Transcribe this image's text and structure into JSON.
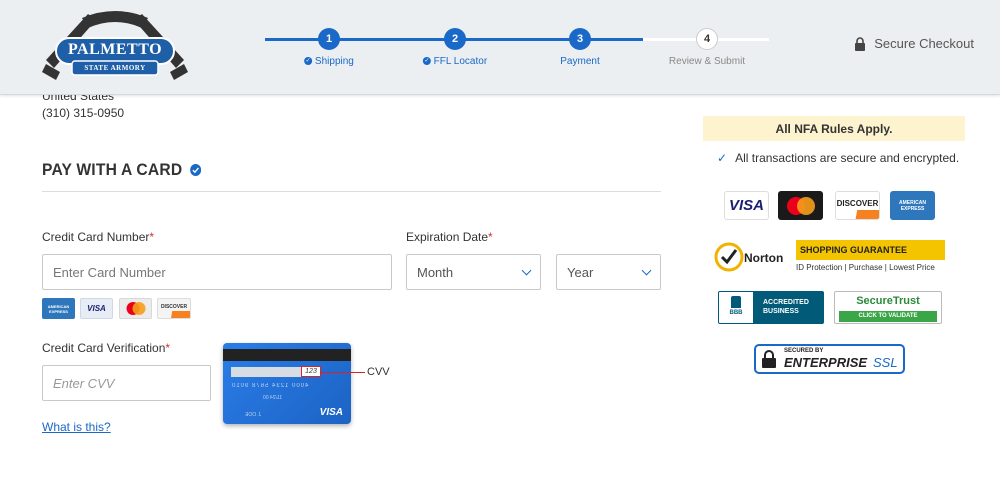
{
  "header": {
    "logo": {
      "top_text": "PALMETTO",
      "bottom_text": "STATE ARMORY"
    },
    "steps": [
      {
        "number": "1",
        "label": "Shipping",
        "done": true
      },
      {
        "number": "2",
        "label": "FFL Locator",
        "done": true
      },
      {
        "number": "3",
        "label": "Payment",
        "done": true
      },
      {
        "number": "4",
        "label": "Review & Submit",
        "done": false
      }
    ],
    "secure_label": "Secure Checkout"
  },
  "address": {
    "country": "United States",
    "phone": "(310) 315-0950"
  },
  "payment": {
    "title": "PAY WITH A CARD",
    "card_number_label": "Credit Card Number",
    "card_number_placeholder": "Enter Card Number",
    "expiration_label": "Expiration Date",
    "month_value": "Month",
    "year_value": "Year",
    "required_mark": "*",
    "accepted_cards": [
      {
        "name": "AMERICAN EXPRESS",
        "icon": "amex-icon"
      },
      {
        "name": "VISA",
        "icon": "visa-icon"
      },
      {
        "name": "MASTERCARD",
        "icon": "mastercard-icon"
      },
      {
        "name": "DISCOVER",
        "icon": "discover-icon"
      }
    ],
    "cvv_label": "Credit Card Verification",
    "cvv_placeholder": "Enter CVV",
    "what_is_this": "What is this?",
    "cvv_illustration": {
      "code": "123",
      "callout": "CVV",
      "number_line": "4000 1234 5678 9010",
      "number_sub": "11/24  00",
      "tiny": "J. DOE",
      "brand": "VISA"
    }
  },
  "sidebar": {
    "nfa_notice": "All NFA Rules Apply.",
    "secure_note": "All transactions are secure and encrypted.",
    "card_logos": [
      "VISA",
      "MASTERCARD",
      "DISCOVER",
      "AMERICAN EXPRESS"
    ],
    "norton": {
      "name": "Norton",
      "guarantee": "SHOPPING GUARANTEE",
      "guarantee_sub": "ID Protection | Purchase | Lowest Price"
    },
    "bbb": {
      "line1": "ACCREDITED",
      "line2": "BUSINESS",
      "short": "BBB"
    },
    "securetrust": {
      "name": "SecureTrust",
      "sub": "CLICK TO VALIDATE"
    },
    "enterprise_ssl": {
      "top": "SECURED BY",
      "name": "ENTERPRISE",
      "suffix": "SSL"
    }
  },
  "colors": {
    "accent": "#1a68c7",
    "required": "#cc3333",
    "nfa_bg": "#fdf3cf"
  }
}
